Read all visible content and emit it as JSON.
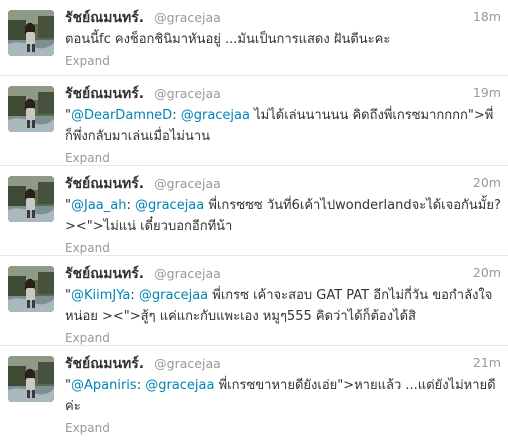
{
  "tweets": [
    {
      "name": "รัชย์ณมนทร์.",
      "screen_name": "@gracejaa",
      "time": "18m",
      "segments": [
        {
          "type": "text",
          "value": "ตอนนี้fc คงช็อกชินิมาหันอยู่ ...มันเป็นการแสดง ฝันดีนะคะ"
        }
      ],
      "expand_label": "Expand"
    },
    {
      "name": "รัชย์ณมนทร์.",
      "screen_name": "@gracejaa",
      "time": "19m",
      "segments": [
        {
          "type": "text",
          "value": "\""
        },
        {
          "type": "mention",
          "value": "@DearDamneD"
        },
        {
          "type": "text",
          "value": ": "
        },
        {
          "type": "mention",
          "value": "@gracejaa"
        },
        {
          "type": "text",
          "value": " ไม่ได้เล่นนานนน คิดถึงพี่เกรซมากกกก\">พี่ก็พึ่งกลับมาเล่นเมื่อไม่นาน"
        }
      ],
      "expand_label": "Expand"
    },
    {
      "name": "รัชย์ณมนทร์.",
      "screen_name": "@gracejaa",
      "time": "20m",
      "segments": [
        {
          "type": "text",
          "value": "\""
        },
        {
          "type": "mention",
          "value": "@Jaa_ah"
        },
        {
          "type": "text",
          "value": ": "
        },
        {
          "type": "mention",
          "value": "@gracejaa"
        },
        {
          "type": "text",
          "value": " พี่เกรซซซ วันที่6เค้าไปwonderlandจะได้เจอกันมั้ย? ><\">ไม่แน่ เดี๋ยวบอกอีกทีน้า"
        }
      ],
      "expand_label": "Expand"
    },
    {
      "name": "รัชย์ณมนทร์.",
      "screen_name": "@gracejaa",
      "time": "20m",
      "segments": [
        {
          "type": "text",
          "value": "\""
        },
        {
          "type": "mention",
          "value": "@KiimJYa"
        },
        {
          "type": "text",
          "value": ": "
        },
        {
          "type": "mention",
          "value": "@gracejaa"
        },
        {
          "type": "text",
          "value": " พี่เกรซ เค้าจะสอบ GAT PAT อีกไม่กี่วัน ขอกำลังใจหน่อย ><\">สู้ๆ แค่แกะกับแพะเอง หมูๆ555 คิดว่าได้ก็ต้องได้สิ"
        }
      ],
      "expand_label": "Expand"
    },
    {
      "name": "รัชย์ณมนทร์.",
      "screen_name": "@gracejaa",
      "time": "21m",
      "segments": [
        {
          "type": "text",
          "value": "\""
        },
        {
          "type": "mention",
          "value": "@Apaniris"
        },
        {
          "type": "text",
          "value": ": "
        },
        {
          "type": "mention",
          "value": "@gracejaa"
        },
        {
          "type": "text",
          "value": " พี่เกรซขาหายดียังเอ่ย\">หายแล้ว ...แต่ยังไม่หายดีค่ะ"
        }
      ],
      "expand_label": "Expand"
    }
  ],
  "colors": {
    "link": "#0084b4",
    "meta": "#999999",
    "text": "#333333",
    "divider": "#e8e8e8"
  },
  "icons": {
    "avatar": "user-avatar-photo"
  }
}
